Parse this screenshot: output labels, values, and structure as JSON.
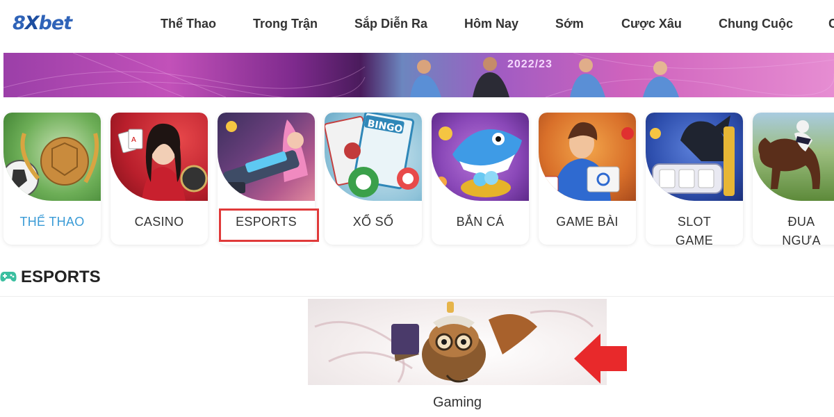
{
  "brand": {
    "logo_text": "8Xbet",
    "accent": "#2f63b8"
  },
  "nav": {
    "items": [
      "Thể Thao",
      "Trong Trận",
      "Sắp Diễn Ra",
      "Hôm Nay",
      "Sớm",
      "Cược Xâu",
      "Chung Cuộc",
      "C"
    ]
  },
  "banner": {
    "season_text": "2022/23"
  },
  "categories": [
    {
      "label": "THỂ THAO",
      "icon": "sports-trophy-icon",
      "active": true
    },
    {
      "label": "CASINO",
      "icon": "casino-cards-icon",
      "active": false
    },
    {
      "label": "ESPORTS",
      "icon": "esports-gun-icon",
      "active": false,
      "highlighted": true
    },
    {
      "label": "XỔ SỐ",
      "icon": "lottery-bingo-icon",
      "active": false
    },
    {
      "label": "BẮN CÁ",
      "icon": "fish-shooting-icon",
      "active": false
    },
    {
      "label": "GAME BÀI",
      "icon": "card-game-icon",
      "active": false
    },
    {
      "label": "SLOT GAME",
      "label_line1": "SLOT",
      "label_line2": "GAME",
      "icon": "slot-machine-icon",
      "active": false
    },
    {
      "label": "ĐUA NGỰA",
      "label_line1": "ĐUA",
      "label_line2": "NGỰA",
      "icon": "horse-racing-icon",
      "active": false
    }
  ],
  "section": {
    "title": "ESPORTS",
    "icon": "gamepad-icon"
  },
  "products": [
    {
      "label": "Gaming",
      "icon": "esports-owl-hero-icon"
    }
  ],
  "colors": {
    "active_tab": "#3a9bd6",
    "highlight": "#e03a3a",
    "arrow": "#e8292b",
    "section_icon": "#3bbfa0"
  }
}
